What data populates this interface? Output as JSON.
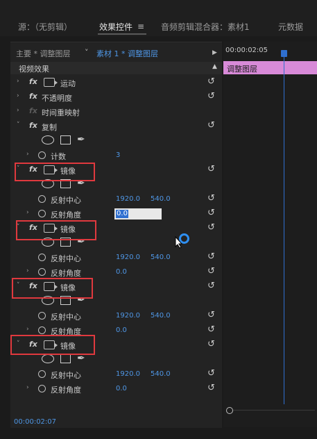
{
  "tabs": {
    "source": "源：（无剪辑）",
    "effect_controls": "效果控件",
    "audio_mixer": "音频剪辑混合器：素材1",
    "metadata": "元数据",
    "menu_glyph": "≡"
  },
  "header": {
    "master": "主要 * 调整图层",
    "clip": "素材 1 * 调整图层",
    "play": "▶"
  },
  "section": {
    "label": "视频效果",
    "collapse": "▲"
  },
  "effects": {
    "motion": "运动",
    "opacity": "不透明度",
    "time_remap": "时间重映射",
    "replicate": "复制",
    "count_label": "计数",
    "count_value": "3"
  },
  "mirror": {
    "name": "镜像",
    "center_label": "反射中心",
    "center_x": "1920.0",
    "center_y": "540.0",
    "angle_label": "反射角度",
    "angle_value": "0.0"
  },
  "icons": {
    "fx": "fx",
    "reset": "↺",
    "pen": "✒",
    "twirl_open": "˅",
    "twirl_closed": "›"
  },
  "timeline": {
    "timecode": "00:00:02:05",
    "clip_label": "调整图层"
  },
  "footer": {
    "time": "00:00:02:07"
  },
  "colors": {
    "accent": "#2f6fd0",
    "value": "#4f97e6",
    "clip": "#d88ad8",
    "highlight_box": "#e0393e"
  }
}
